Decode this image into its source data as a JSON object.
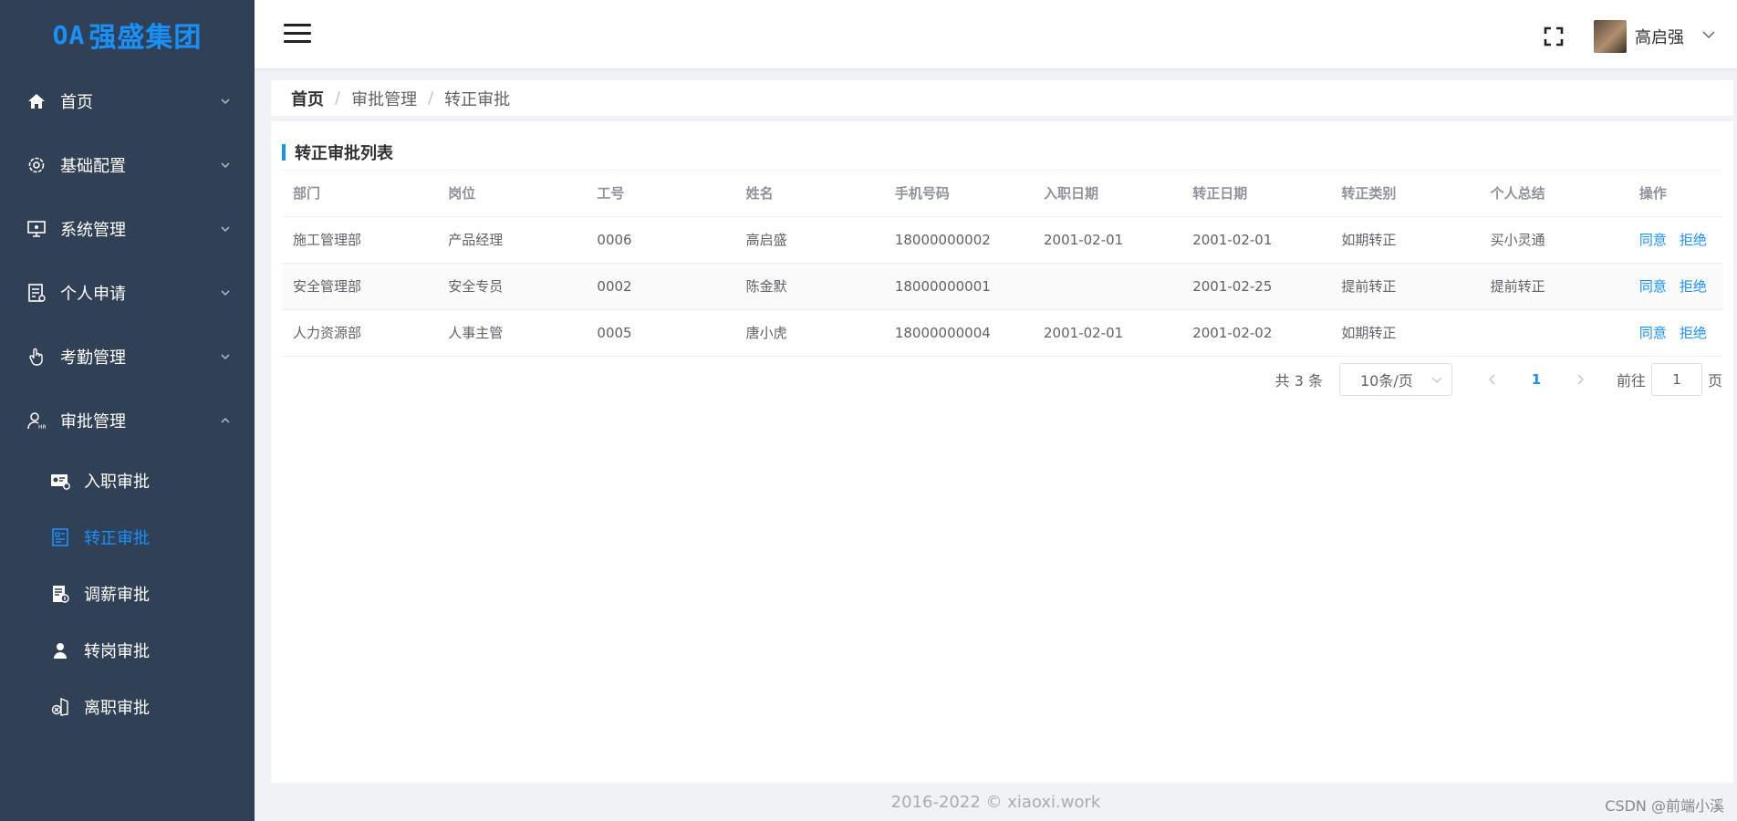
{
  "brand": {
    "mark": "OA",
    "name": "强盛集团",
    "color": "#1890ff"
  },
  "sidebar": {
    "items": [
      {
        "label": "首页",
        "icon": "home-icon"
      },
      {
        "label": "基础配置",
        "icon": "gear-icon"
      },
      {
        "label": "系统管理",
        "icon": "monitor-icon"
      },
      {
        "label": "个人申请",
        "icon": "document-icon"
      },
      {
        "label": "考勤管理",
        "icon": "hand-icon"
      },
      {
        "label": "审批管理",
        "icon": "user-hr-icon"
      }
    ],
    "sub_items": [
      {
        "label": "入职审批",
        "icon": "id-card-icon"
      },
      {
        "label": "转正审批",
        "icon": "form-icon",
        "active": true
      },
      {
        "label": "调薪审批",
        "icon": "salary-doc-icon"
      },
      {
        "label": "转岗审批",
        "icon": "person-icon"
      },
      {
        "label": "离职审批",
        "icon": "exit-icon"
      }
    ]
  },
  "header": {
    "user_name": "高启强"
  },
  "breadcrumb": [
    "首页",
    "审批管理",
    "转正审批"
  ],
  "panel": {
    "title": "转正审批列表"
  },
  "table": {
    "columns": [
      "部门",
      "岗位",
      "工号",
      "姓名",
      "手机号码",
      "入职日期",
      "转正日期",
      "转正类别",
      "个人总结",
      "操作"
    ],
    "rows": [
      [
        "施工管理部",
        "产品经理",
        "0006",
        "高启盛",
        "18000000002",
        "2001-02-01",
        "2001-02-01",
        "如期转正",
        "买小灵通"
      ],
      [
        "安全管理部",
        "安全专员",
        "0002",
        "陈金默",
        "18000000001",
        "",
        "2001-02-25",
        "提前转正",
        "提前转正"
      ],
      [
        "人力资源部",
        "人事主管",
        "0005",
        "唐小虎",
        "18000000004",
        "2001-02-01",
        "2001-02-02",
        "如期转正",
        ""
      ]
    ],
    "actions": [
      "同意",
      "拒绝"
    ]
  },
  "pagination": {
    "total_text": "共 3 条",
    "page_size": "10条/页",
    "current_page": "1",
    "goto_label": "前往",
    "goto_value": "1",
    "unit": "页"
  },
  "footer": {
    "copyright": "2016-2022 © xiaoxi.work",
    "watermark": "CSDN @前端小溪"
  }
}
